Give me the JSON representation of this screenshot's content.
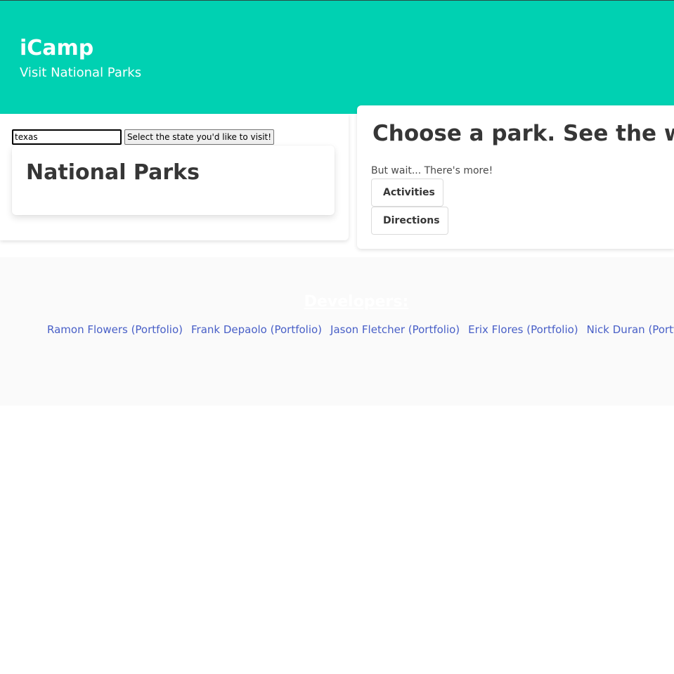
{
  "hero": {
    "title": "iCamp",
    "subtitle": "Visit National Parks"
  },
  "search": {
    "value": "texas",
    "button_label": "Select the state you'd like to visit!"
  },
  "parks": {
    "title": "National Parks"
  },
  "weather": {
    "title": "Choose a park. See the weath",
    "more_text": "But wait... There's more!",
    "activities_label": "Activities",
    "directions_label": "Directions"
  },
  "footer": {
    "heading": "Developers:",
    "developers": [
      "Ramon Flowers (Portfolio)",
      "Frank Depaolo (Portfolio)",
      "Jason Fletcher (Portfolio)",
      "Erix Flores (Portfolio)",
      "Nick Duran (Portfolio)"
    ]
  },
  "colors": {
    "hero_bg": "#00d1b2",
    "link": "#485fc7",
    "footer_bg": "#fafafa"
  }
}
